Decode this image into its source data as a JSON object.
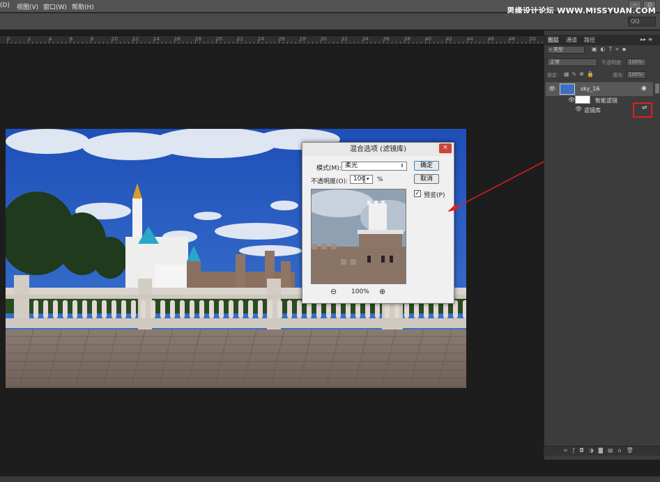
{
  "menu": {
    "items": [
      "(D)",
      "视图(V)",
      "窗口(W)",
      "帮助(H)"
    ]
  },
  "watermark": "思缘设计论坛 WWW.MISSYUAN.COM",
  "window_buttons": [
    "–",
    "▫"
  ],
  "options_bar": {
    "search_placeholder": "QQ"
  },
  "ruler": {
    "numbers": [
      "0",
      "2",
      "4",
      "6",
      "8",
      "10",
      "12",
      "14",
      "16",
      "18",
      "20",
      "22",
      "24",
      "26",
      "28",
      "30",
      "32",
      "34",
      "36",
      "38",
      "40",
      "42",
      "44",
      "46",
      "48",
      "50"
    ]
  },
  "panel": {
    "tabs": [
      "图层",
      "通道",
      "路径"
    ],
    "kind_filter": "类型",
    "blend_mode": "正常",
    "opacity_label": "不透明度:",
    "opacity_value": "100%",
    "lock_label": "锁定:",
    "fill_label": "填充:",
    "fill_value": "100%",
    "layers": [
      {
        "name": "sky_16"
      },
      {
        "name": "智能滤镜"
      },
      {
        "name": "滤镜库"
      }
    ]
  },
  "dialog": {
    "title": "混合选项 (滤镜库)",
    "close": "×",
    "mode_label": "模式(M):",
    "mode_value": "柔光",
    "opacity_label": "不透明度(O):",
    "opacity_value": "100",
    "percent": "%",
    "ok_button": "确定",
    "cancel_button": "取消",
    "preview_label": "预览(P)",
    "preview_checked": true,
    "zoom_value": "100%"
  },
  "colors": {
    "accent_red": "#e0201e",
    "panel_bg": "#3c3c3c",
    "app_bg": "#1d1d1d"
  }
}
